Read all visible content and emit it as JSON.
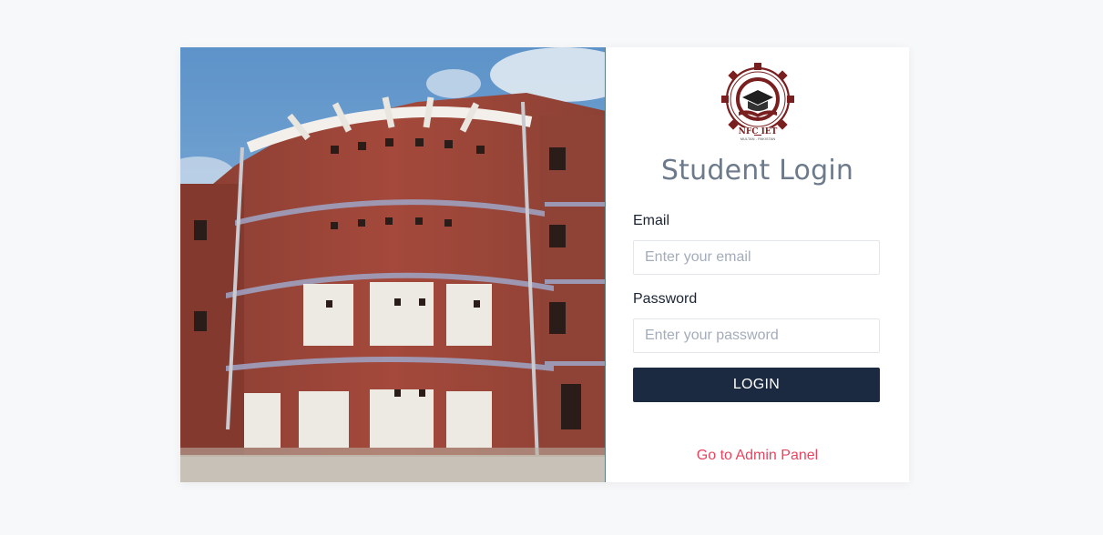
{
  "campus_image": {
    "icon": "campus-building-photo"
  },
  "logo": {
    "icon": "nfc-iet-logo",
    "ring_text": "NFC INSTITUTE OF ENGINEERING & TECHNOLOGY",
    "name": "NFC IET",
    "location": "MULTAN - PAKISTAN"
  },
  "form": {
    "title": "Student Login",
    "email_label": "Email",
    "email_placeholder": "Enter your email",
    "email_value": "",
    "password_label": "Password",
    "password_placeholder": "Enter your password",
    "password_value": "",
    "login_label": "LOGIN",
    "admin_link": "Go to Admin Panel"
  },
  "colors": {
    "page_bg": "#f7f8fa",
    "button_bg": "#1b2a41",
    "link": "#e9445f",
    "title": "#6c7a8b",
    "logo_maroon": "#7a1f1f"
  }
}
